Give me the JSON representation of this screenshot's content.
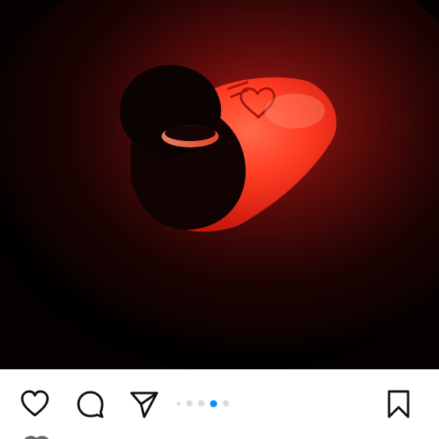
{
  "post": {
    "photo_alt": "",
    "actions": {
      "like_icon": "heart-outline-icon",
      "comment_icon": "comment-bubble-icon",
      "share_icon": "paper-plane-icon",
      "save_icon": "bookmark-outline-icon"
    },
    "carousel": {
      "total": 5,
      "current": 4,
      "active_color": "#0095f6",
      "inactive_color": "#dbdbdb"
    }
  }
}
